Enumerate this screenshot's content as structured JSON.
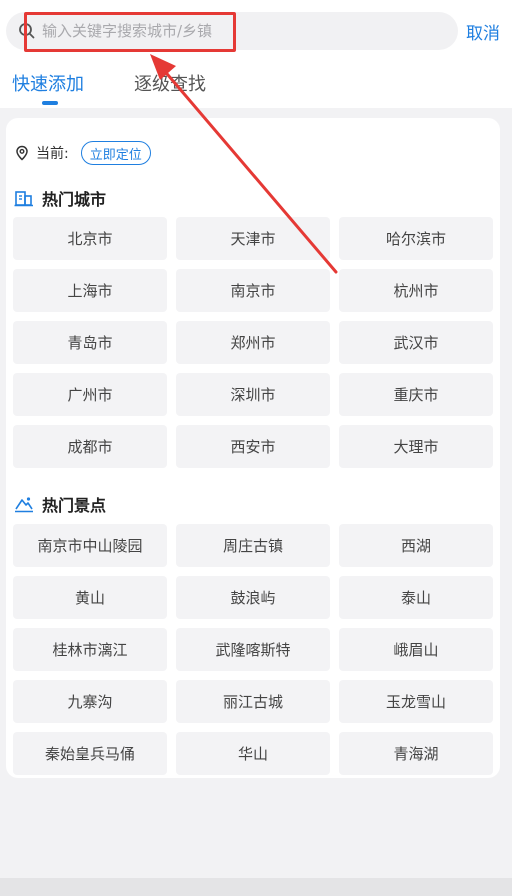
{
  "search": {
    "placeholder": "输入关键字搜索城市/乡镇",
    "value": "",
    "cancel_label": "取消"
  },
  "tabs": [
    {
      "label": "快速添加",
      "active": true
    },
    {
      "label": "逐级查找",
      "active": false
    }
  ],
  "current": {
    "label": "当前:",
    "locate_label": "立即定位"
  },
  "hot_cities": {
    "title": "热门城市",
    "items": [
      "北京市",
      "天津市",
      "哈尔滨市",
      "上海市",
      "南京市",
      "杭州市",
      "青岛市",
      "郑州市",
      "武汉市",
      "广州市",
      "深圳市",
      "重庆市",
      "成都市",
      "西安市",
      "大理市"
    ]
  },
  "hot_spots": {
    "title": "热门景点",
    "items": [
      "南京市中山陵园",
      "周庄古镇",
      "西湖",
      "黄山",
      "鼓浪屿",
      "泰山",
      "桂林市漓江",
      "武隆喀斯特",
      "峨眉山",
      "九寨沟",
      "丽江古城",
      "玉龙雪山",
      "秦始皇兵马俑",
      "华山",
      "青海湖"
    ]
  },
  "colors": {
    "accent": "#1f7fe0",
    "annotation": "#e53935",
    "chip_bg": "#f3f3f5",
    "page_bg": "#f2f2f4"
  },
  "icons": {
    "search": "search-icon",
    "pin": "location-pin-icon",
    "city": "building-icon",
    "spot": "mountain-icon"
  }
}
